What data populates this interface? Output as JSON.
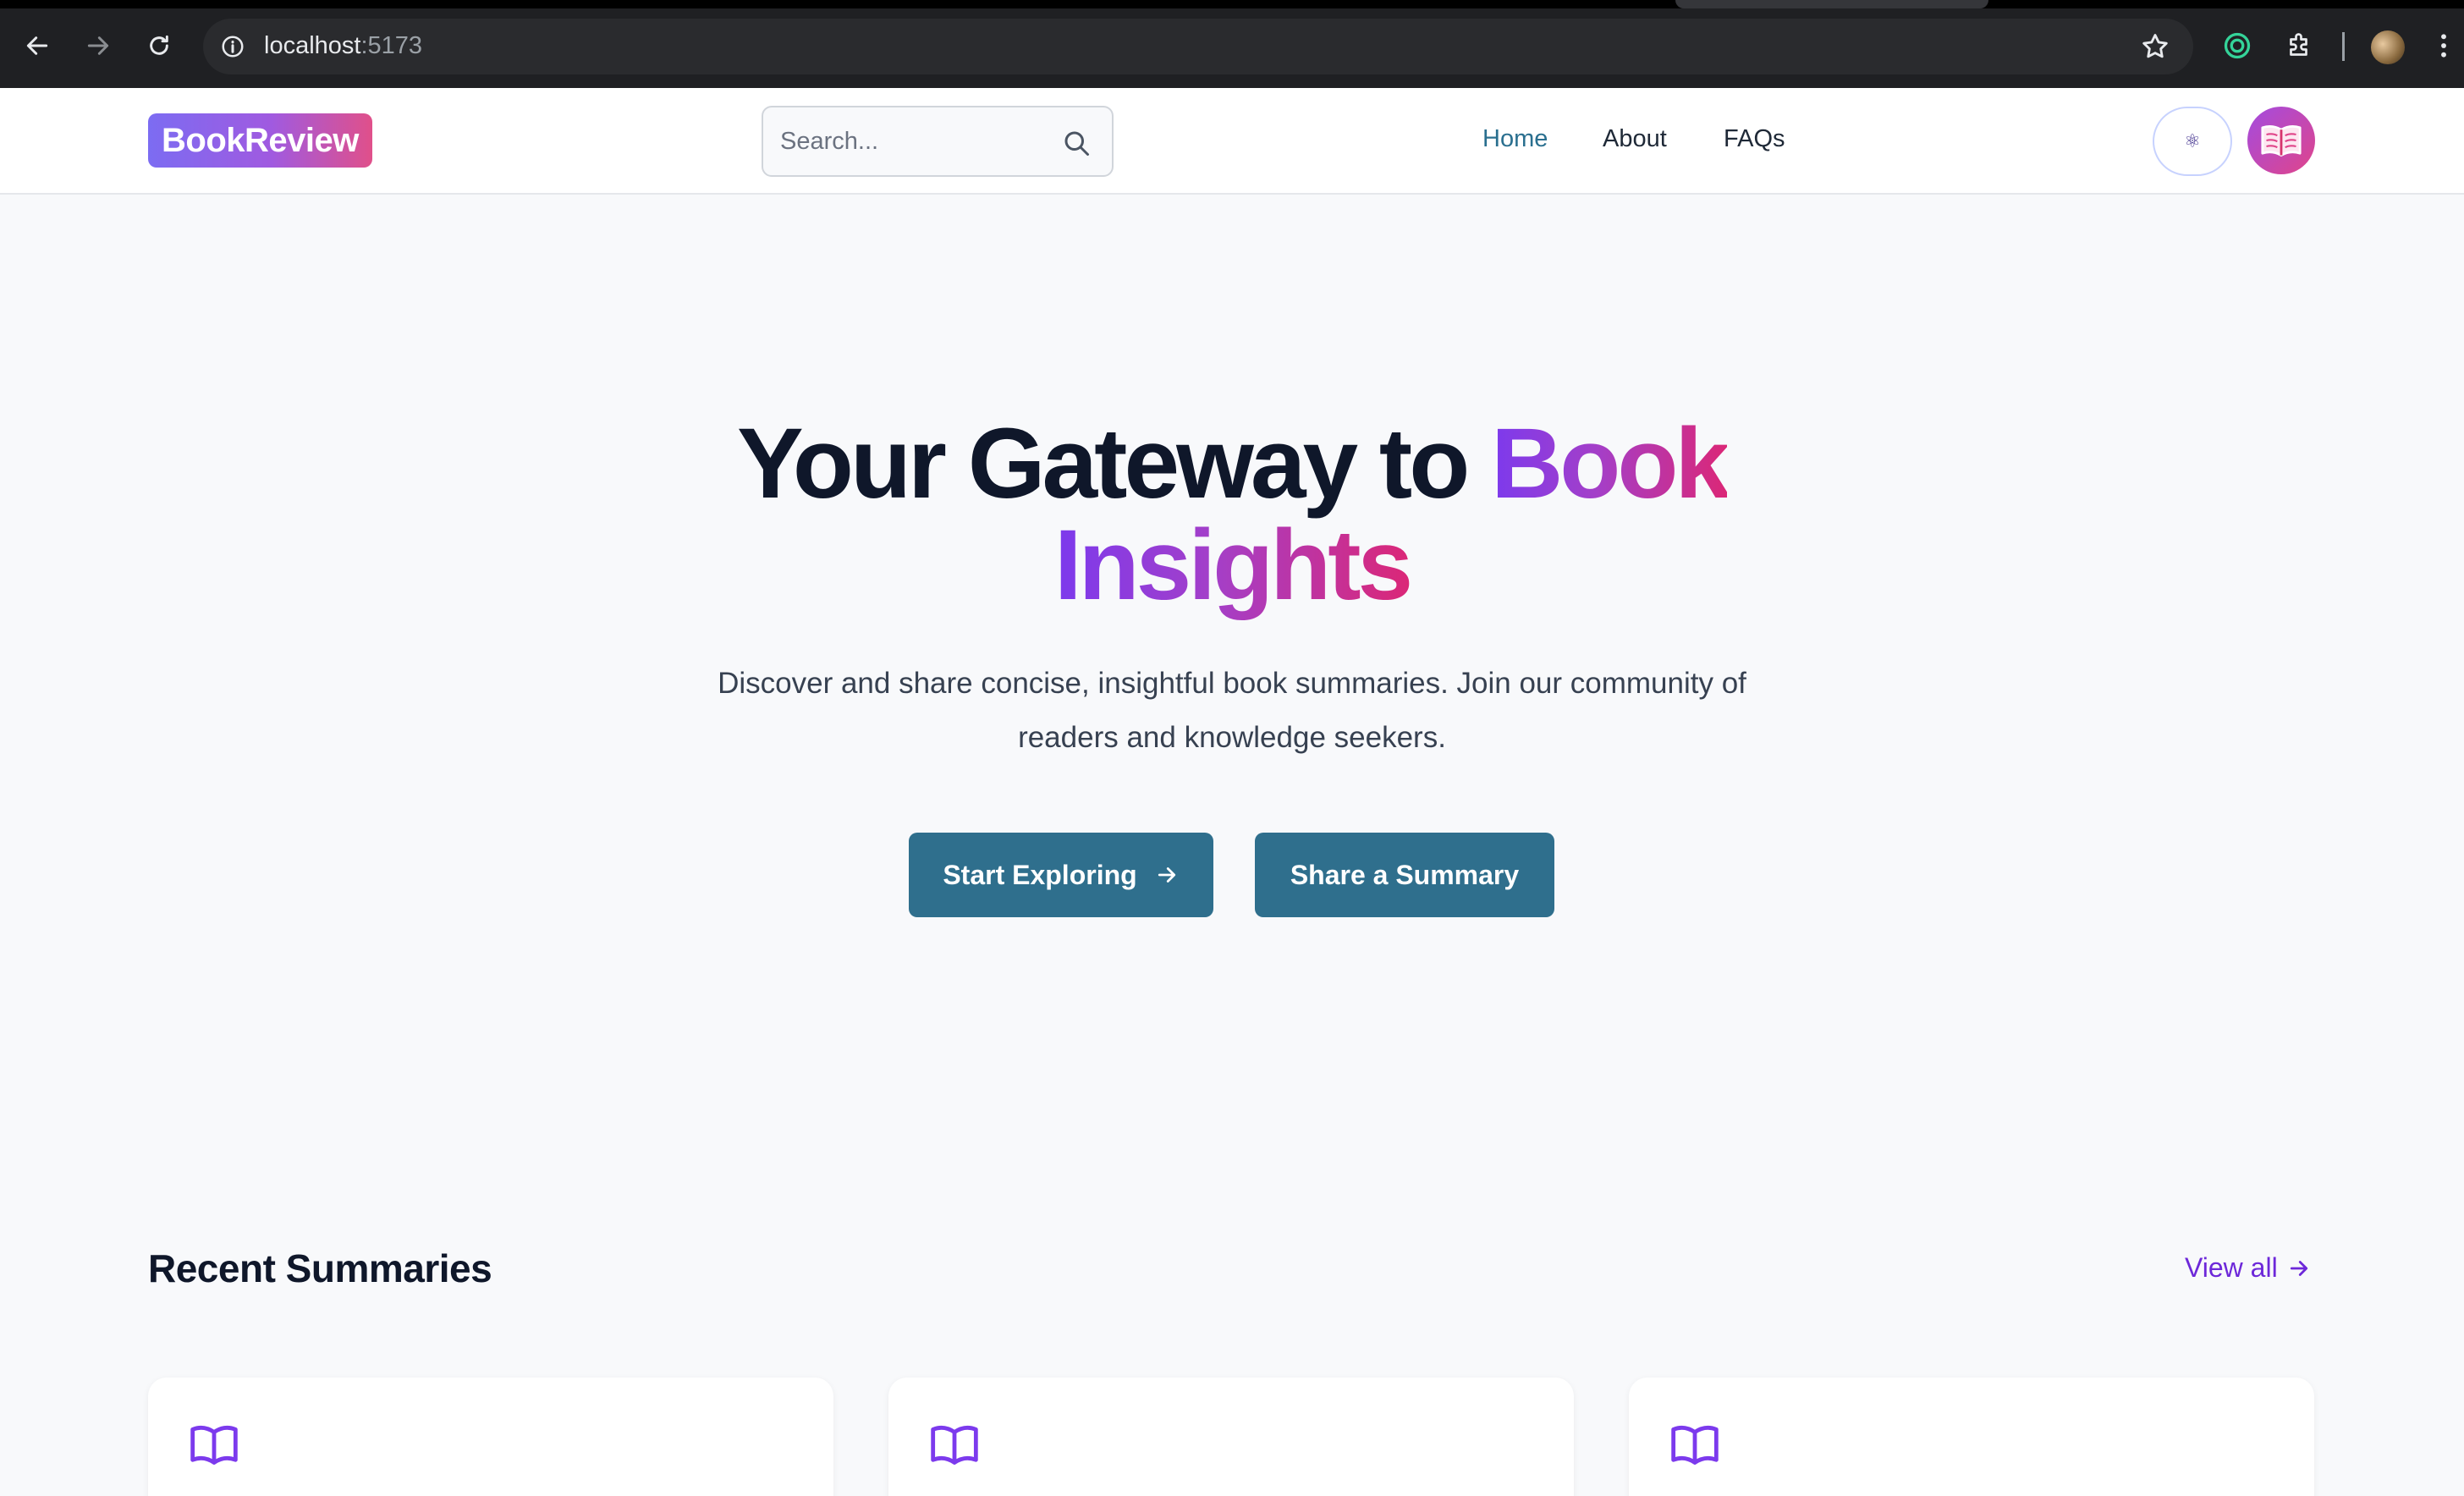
{
  "browser": {
    "url_host": "localhost",
    "url_port": ":5173"
  },
  "header": {
    "logo": "BookReview",
    "search_placeholder": "Search...",
    "nav": [
      {
        "label": "Home",
        "active": true
      },
      {
        "label": "About",
        "active": false
      },
      {
        "label": "FAQs",
        "active": false
      }
    ],
    "theme_toggle_icon": "⚛"
  },
  "hero": {
    "title_plain": "Your Gateway to ",
    "title_highlight_1": "Book",
    "title_highlight_2": "Insights",
    "subtitle_line1": "Discover and share concise, insightful book summaries. Join our community of",
    "subtitle_line2": "readers and knowledge seekers.",
    "primary_cta": "Start Exploring",
    "secondary_cta": "Share a Summary"
  },
  "recent": {
    "title": "Recent Summaries",
    "view_all": "View all"
  },
  "colors": {
    "accent": "#2f6f8d",
    "brand_purple": "#7c3aed",
    "brand_pink": "#db2777",
    "link_purple": "#6d28d9"
  }
}
